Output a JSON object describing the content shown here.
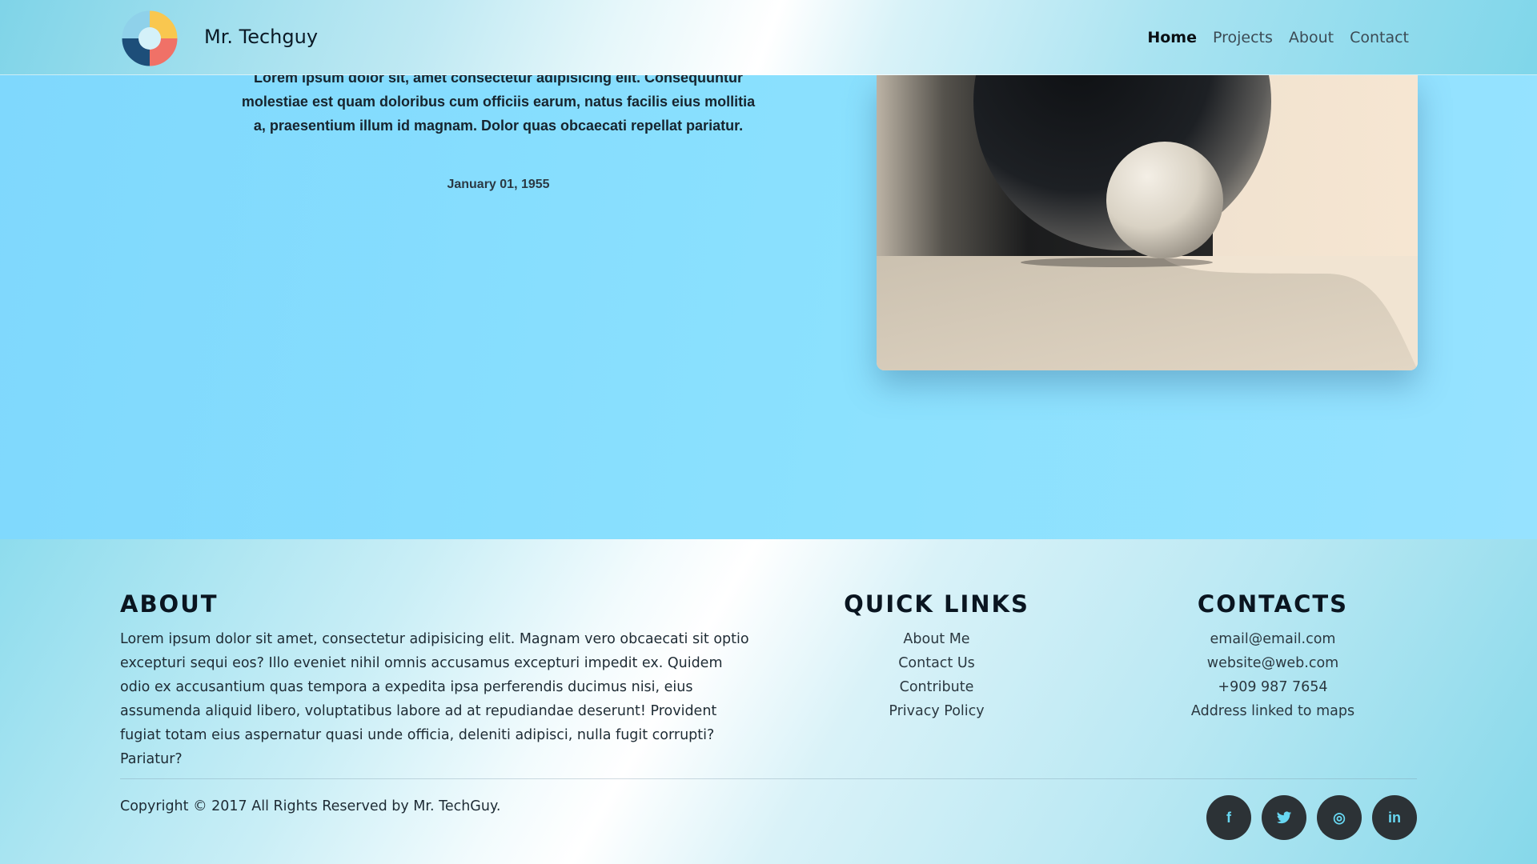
{
  "header": {
    "brand": "Mr. Techguy",
    "nav": [
      {
        "label": "Home",
        "active": true
      },
      {
        "label": "Projects",
        "active": false
      },
      {
        "label": "About",
        "active": false
      },
      {
        "label": "Contact",
        "active": false
      }
    ]
  },
  "hero": {
    "text": "Lorem ipsum dolor sit, amet consectetur adipisicing elit. Consequuntur molestiae est quam doloribus cum officiis earum, natus facilis eius mollitia a, praesentium illum id magnam. Dolor quas obcaecati repellat pariatur.",
    "date": "January 01, 1955"
  },
  "footer": {
    "about": {
      "title": "ABOUT",
      "text": "Lorem ipsum dolor sit amet, consectetur adipisicing elit. Magnam vero obcaecati sit optio excepturi sequi eos? Illo eveniet nihil omnis accusamus excepturi impedit ex. Quidem odio ex accusantium quas tempora a expedita ipsa perferendis ducimus nisi, eius assumenda aliquid libero, voluptatibus labore ad at repudiandae deserunt! Provident fugiat totam eius aspernatur quasi unde officia, deleniti adipisci, nulla fugit corrupti? Pariatur?"
    },
    "quick_links": {
      "title": "QUICK LINKS",
      "items": [
        "About Me",
        "Contact Us",
        "Contribute",
        "Privacy Policy"
      ]
    },
    "contacts": {
      "title": "CONTACTS",
      "items": [
        "email@email.com",
        "website@web.com",
        "+909 987 7654",
        "Address linked to maps"
      ]
    },
    "copyright": "Copyright © 2017 All Rights Reserved by Mr. TechGuy.",
    "socials": [
      {
        "icon": "facebook-icon",
        "glyph": "f"
      },
      {
        "icon": "twitter-icon",
        "glyph": "t"
      },
      {
        "icon": "dribbble-icon",
        "glyph": "◎"
      },
      {
        "icon": "linkedin-icon",
        "glyph": "in"
      }
    ]
  },
  "colors": {
    "hero_bg": "#86dcfc",
    "social_bg": "#2c3236",
    "social_fg": "#68d7f2"
  }
}
